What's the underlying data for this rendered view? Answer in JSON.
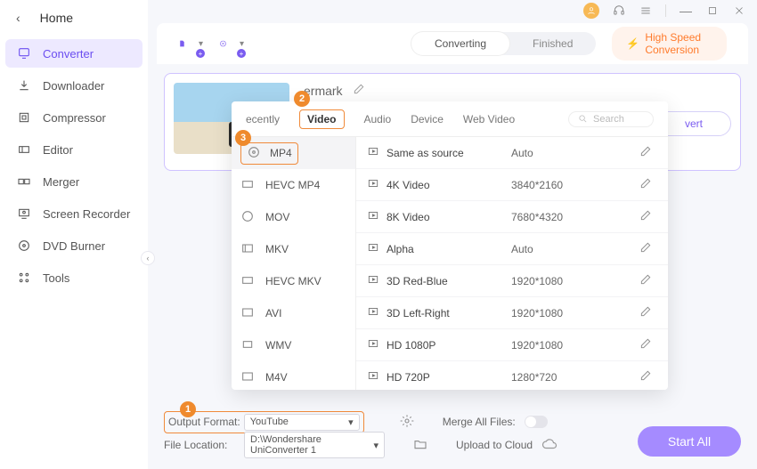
{
  "titlebar": {
    "tooltip_user": "user"
  },
  "sidebar": {
    "home": "Home",
    "items": [
      {
        "label": "Converter",
        "icon": "convert"
      },
      {
        "label": "Downloader",
        "icon": "download"
      },
      {
        "label": "Compressor",
        "icon": "compress"
      },
      {
        "label": "Editor",
        "icon": "editor"
      },
      {
        "label": "Merger",
        "icon": "merger"
      },
      {
        "label": "Screen Recorder",
        "icon": "screenrec"
      },
      {
        "label": "DVD Burner",
        "icon": "dvd"
      },
      {
        "label": "Tools",
        "icon": "tools"
      }
    ]
  },
  "toolbar": {
    "segment": {
      "converting": "Converting",
      "finished": "Finished"
    },
    "highspeed": "High Speed Conversion"
  },
  "card": {
    "title_fragment": "ermark",
    "convert": "vert"
  },
  "popup": {
    "tabs": [
      "ecently",
      "Video",
      "Audio",
      "Device",
      "Web Video"
    ],
    "search_placeholder": "Search",
    "formats": [
      "MP4",
      "HEVC MP4",
      "MOV",
      "MKV",
      "HEVC MKV",
      "AVI",
      "WMV",
      "M4V"
    ],
    "presets": [
      {
        "name": "Same as source",
        "res": "Auto"
      },
      {
        "name": "4K Video",
        "res": "3840*2160"
      },
      {
        "name": "8K Video",
        "res": "7680*4320"
      },
      {
        "name": "Alpha",
        "res": "Auto"
      },
      {
        "name": "3D Red-Blue",
        "res": "1920*1080"
      },
      {
        "name": "3D Left-Right",
        "res": "1920*1080"
      },
      {
        "name": "HD 1080P",
        "res": "1920*1080"
      },
      {
        "name": "HD 720P",
        "res": "1280*720"
      }
    ]
  },
  "bottom": {
    "output_label": "Output Format:",
    "output_value": "YouTube",
    "file_label": "File Location:",
    "file_value": "D:\\Wondershare UniConverter 1",
    "merge_label": "Merge All Files:",
    "upload_label": "Upload to Cloud",
    "start": "Start All"
  },
  "steps": {
    "s1": "1",
    "s2": "2",
    "s3": "3"
  }
}
